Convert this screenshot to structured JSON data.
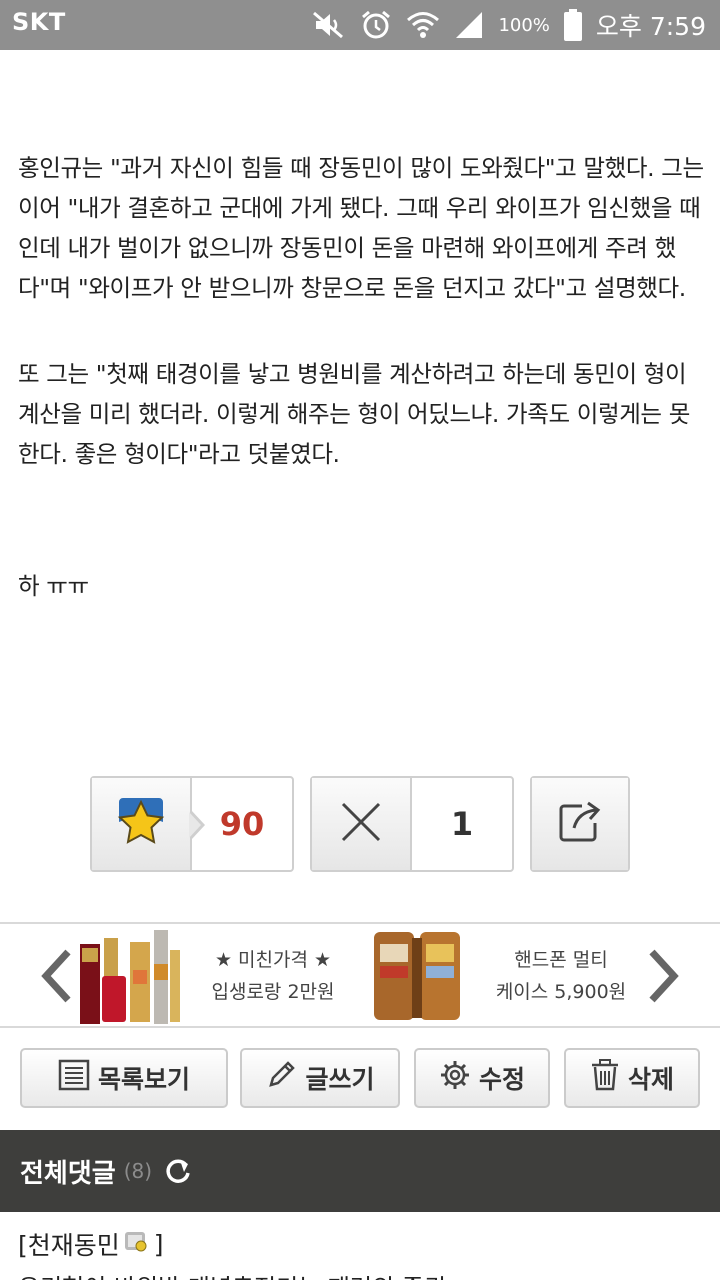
{
  "status_bar": {
    "carrier": "SKT",
    "battery": "100%",
    "time": "오후 7:59",
    "icons": [
      "mute-icon",
      "alarm-icon",
      "wifi-icon",
      "signal-icon",
      "battery-icon"
    ]
  },
  "article": {
    "para1": "홍인규는 \"과거 자신이 힘들 때 장동민이 많이 도와줬다\"고 말했다. 그는 이어 \"내가 결혼하고 군대에 가게 됐다. 그때 우리 와이프가 임신했을 때인데 내가 벌이가 없으니까 장동민이 돈을 마련해 와이프에게 주려 했다\"며 \"와이프가 안 받으니까 창문으로 돈을 던지고 갔다\"고 설명했다.",
    "para2": "또 그는 \"첫째 태경이를 낳고 병원비를 계산하려고 하는데 동민이 형이 계산을 미리 했더라. 이렇게 해주는 형이 어딨느냐. 가족도 이렇게는 못한다. 좋은 형이다\"라고 덧붙였다.",
    "para3": "하 ㅠㅠ"
  },
  "votes": {
    "like_count": "90",
    "dislike_count": "1"
  },
  "ads": {
    "left_line1": "★ 미친가격 ★",
    "left_line2": "입생로랑 2만원",
    "right_line1": "핸드폰 멀티",
    "right_line2": "케이스 5,900원"
  },
  "buttons": {
    "list": "목록보기",
    "write": "글쓰기",
    "edit": "수정",
    "delete": "삭제"
  },
  "comments": {
    "title": "전체댓글",
    "count": "(8)",
    "first_author": "[천재동민",
    "first_author_close": "]",
    "first_text": "우리형이 바위발 개념충전기는 패러의 존귀"
  },
  "colors": {
    "status_bar": "#8f8f8f",
    "like_count": "#c0392b",
    "comment_header": "#3e3e3c"
  }
}
